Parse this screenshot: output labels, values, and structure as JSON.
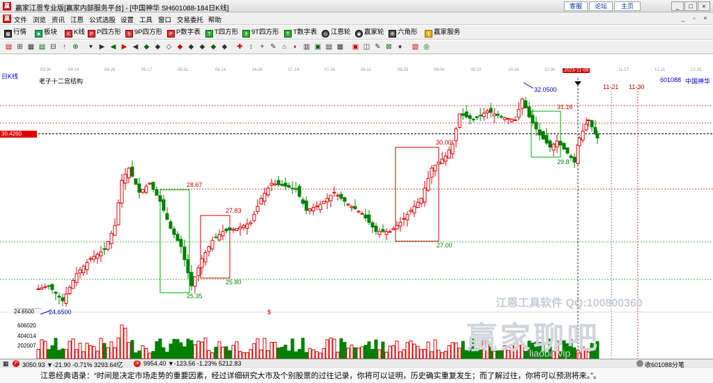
{
  "window": {
    "title": "赢家江恩专业版[赢家内部服务平台] - [中国神华  SH601088-184日K线]",
    "links": [
      "客服",
      "论坛",
      "主页"
    ],
    "controls": [
      "_",
      "□",
      "×"
    ]
  },
  "menu": [
    "文件",
    "浏览",
    "资讯",
    "江恩",
    "公式选股",
    "设置",
    "工具",
    "窗口",
    "交易委托",
    "帮助"
  ],
  "toolbar_tabs": [
    "行情",
    "板块",
    "K线",
    "P四方形",
    "9P四方形",
    "P数字表",
    "T四方形",
    "9T四方形",
    "T数字表",
    "江恩轮",
    "赢家轮",
    "六角形",
    "赢家服务"
  ],
  "dates": [
    "03-30",
    "04-14",
    "04-28",
    "05-17",
    "05-31",
    "06-14",
    "06-30",
    "07-14",
    "07-28",
    "08-11",
    "08-25",
    "09-08",
    "09-22",
    "10-16",
    "10-30",
    "2023-11-08",
    "11-27",
    "12-11",
    "12-25"
  ],
  "current_date": "2023-11-08",
  "chart": {
    "mode": "日K线",
    "name": "老子十二宫结构",
    "stock_code": "601088",
    "stock_name": "中国神华",
    "price_tag": "30.4260",
    "high_label": "32.0500",
    "low_label": "24.6500",
    "left_axis_low": "24.6500",
    "future_dates": [
      "11-21",
      "11-30"
    ],
    "level_labels": [
      "28.67",
      "27.83",
      "25.80",
      "25.35",
      "30.00",
      "27.00",
      "31.16",
      "29.8"
    ],
    "volume_axis": [
      "606020",
      "404014",
      "202007"
    ],
    "dollar_mark": "$"
  },
  "chart_data": {
    "type": "candlestick",
    "title": "老子十二宫结构",
    "levels": [
      28.67,
      27.83,
      25.8,
      25.35,
      30.0,
      27.0,
      31.16,
      29.8,
      32.05,
      24.65
    ],
    "ylim": [
      24.5,
      32.6
    ],
    "current_price": 30.426,
    "high": 32.05,
    "low": 24.65
  },
  "status": {
    "sh_label": "沪",
    "sh_value": "3050.93 ▼-21.90 -0.71% 3293.64亿",
    "sz_label": "深",
    "sz_value": "9954.40 ▼-123.56 -1.23% 5212.83",
    "right": "收601088分笔"
  },
  "watermark": {
    "line1": "江恩工具软件  QQ:100800360",
    "line2": "赢家聊吧",
    "line3": "liaoba.vip"
  },
  "quote": "江恩经典语录：“时间是决定市场走势的重要因素，经过详细研究大市及个别股票的过往记录，你将可以证明，历史确实重复发生；而了解过往，你将可以预测将来。”。"
}
